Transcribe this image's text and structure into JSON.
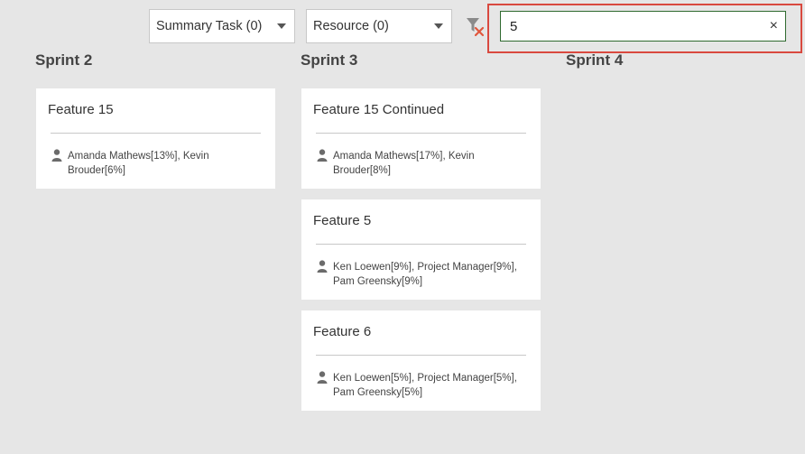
{
  "filters": {
    "summary_task": "Summary Task (0)",
    "resource": "Resource (0)"
  },
  "search": {
    "value": "5",
    "clear_label": "×"
  },
  "sprints": [
    {
      "title": "Sprint 2",
      "cards": [
        {
          "title": "Feature 15",
          "resources": "Amanda Mathews[13%], Kevin Brouder[6%]"
        }
      ]
    },
    {
      "title": "Sprint 3",
      "cards": [
        {
          "title": "Feature 15 Continued",
          "resources": "Amanda Mathews[17%], Kevin Brouder[8%]"
        },
        {
          "title": "Feature 5",
          "resources": "Ken Loewen[9%], Project Manager[9%], Pam Greensky[9%]"
        },
        {
          "title": "Feature 6",
          "resources": "Ken Loewen[5%], Project Manager[5%], Pam Greensky[5%]"
        }
      ]
    },
    {
      "title": "Sprint 4",
      "cards": []
    }
  ],
  "icons": {
    "clear_filter": "filter-clear-icon",
    "person": "person-icon"
  },
  "colors": {
    "background": "#e6e6e6",
    "highlight": "#d9493f",
    "search_border": "#2f6a2f",
    "clear_x": "#e0563c"
  }
}
